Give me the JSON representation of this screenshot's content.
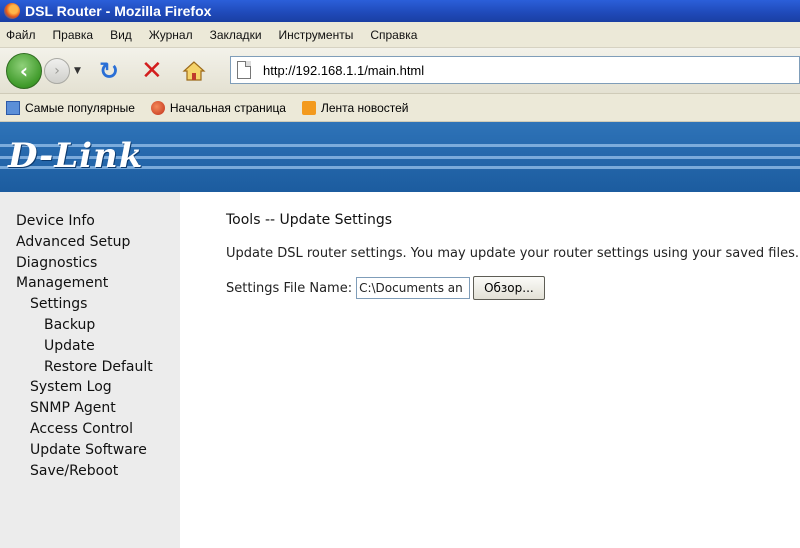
{
  "window": {
    "title": "DSL Router - Mozilla Firefox"
  },
  "menubar": {
    "items": [
      "Файл",
      "Правка",
      "Вид",
      "Журнал",
      "Закладки",
      "Инструменты",
      "Справка"
    ]
  },
  "navbar": {
    "url": "http://192.168.1.1/main.html",
    "icons": [
      "back-icon",
      "forward-icon",
      "reload-icon",
      "stop-icon",
      "home-icon"
    ]
  },
  "bookmarks": {
    "items": [
      {
        "label": "Самые популярные",
        "icon": "bookmark-icon"
      },
      {
        "label": "Начальная страница",
        "icon": "firefox-icon"
      },
      {
        "label": "Лента новостей",
        "icon": "rss-icon"
      }
    ]
  },
  "banner": {
    "logo": "D-Link",
    "colors": {
      "background": "#1f61a7",
      "logo_text": "#ffffff"
    }
  },
  "sidebar": {
    "items": [
      {
        "label": "Device Info",
        "level": 1
      },
      {
        "label": "Advanced Setup",
        "level": 1
      },
      {
        "label": "Diagnostics",
        "level": 1
      },
      {
        "label": "Management",
        "level": 1
      },
      {
        "label": "Settings",
        "level": 2
      },
      {
        "label": "Backup",
        "level": 3
      },
      {
        "label": "Update",
        "level": 3
      },
      {
        "label": "Restore Default",
        "level": 3
      },
      {
        "label": "System Log",
        "level": 2
      },
      {
        "label": "SNMP Agent",
        "level": 2
      },
      {
        "label": "Access Control",
        "level": 2
      },
      {
        "label": "Update Software",
        "level": 2
      },
      {
        "label": "Save/Reboot",
        "level": 2
      }
    ]
  },
  "main": {
    "title": "Tools -- Update Settings",
    "description": "Update DSL router settings. You may update your router settings using your saved files.",
    "file_label": "Settings File Name:",
    "file_value": "C:\\Documents an",
    "browse_label": "Обзор..."
  }
}
